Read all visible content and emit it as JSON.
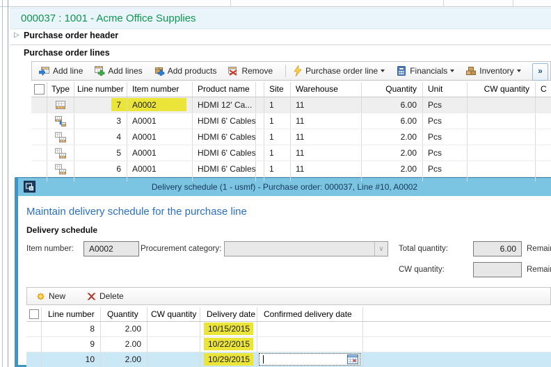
{
  "colors": {
    "accent_green": "#10964f",
    "dialog_border_blue": "#3e95c6",
    "dialog_titlebar_blue": "#7cc5e2",
    "highlight_yellow": "#ebe53a",
    "selected_row_blue": "#cbe8f6",
    "heading_blue": "#2a6fc2"
  },
  "icons": {
    "expander": "▷",
    "overflow": "»",
    "dropdown_caret": "∨"
  },
  "po_form": {
    "title": "000037 : 1001 - Acme Office Supplies",
    "header_section_label": "Purchase order header",
    "lines_section_label": "Purchase order lines",
    "toolbar": {
      "add_line": "Add line",
      "add_lines": "Add lines",
      "add_products": "Add products",
      "remove": "Remove",
      "purchase_order_line": "Purchase order line",
      "financials": "Financials",
      "inventory": "Inventory"
    },
    "grid": {
      "headers": {
        "type": "Type",
        "line": "Line number",
        "item": "Item number",
        "product": "Product name",
        "site": "Site",
        "wh": "Warehouse",
        "qty": "Quantity",
        "unit": "Unit",
        "cw": "CW quantity",
        "last": "C"
      },
      "rows": [
        {
          "line": "7",
          "item": "A0002",
          "product": "HDMI 12' Ca...",
          "site": "1",
          "wh": "11",
          "qty": "6.00",
          "unit": "Pcs"
        },
        {
          "line": "3",
          "item": "A0001",
          "product": "HDMI 6' Cables",
          "site": "1",
          "wh": "11",
          "qty": "6.00",
          "unit": "Pcs"
        },
        {
          "line": "4",
          "item": "A0001",
          "product": "HDMI 6' Cables",
          "site": "1",
          "wh": "11",
          "qty": "2.00",
          "unit": "Pcs"
        },
        {
          "line": "5",
          "item": "A0001",
          "product": "HDMI 6' Cables",
          "site": "1",
          "wh": "11",
          "qty": "2.00",
          "unit": "Pcs"
        },
        {
          "line": "6",
          "item": "A0001",
          "product": "HDMI 6' Cables",
          "site": "1",
          "wh": "11",
          "qty": "2.00",
          "unit": "Pcs"
        }
      ]
    }
  },
  "dialog": {
    "title": "Delivery schedule (1 - usmf) - Purchase order: 000037, Line #10, A0002",
    "heading": "Maintain delivery schedule for the purchase line",
    "group_label": "Delivery schedule",
    "fields": {
      "item_number_label": "Item number:",
      "item_number_value": "A0002",
      "procurement_label": "Procurement category:",
      "procurement_value": "",
      "total_qty_label": "Total quantity:",
      "total_qty_value": "6.00",
      "remaining_label_1": "Remaining",
      "cw_qty_label": "CW quantity:",
      "cw_qty_value": "",
      "remaining_label_2": "Remaining"
    },
    "toolbar": {
      "new": "New",
      "delete": "Delete"
    },
    "grid": {
      "headers": {
        "line": "Line number",
        "qty": "Quantity",
        "cw": "CW quantity",
        "date": "Delivery date",
        "conf": "Confirmed delivery date"
      },
      "rows": [
        {
          "line": "8",
          "qty": "2.00",
          "cw": "",
          "date": "10/15/2015",
          "conf": ""
        },
        {
          "line": "9",
          "qty": "2.00",
          "cw": "",
          "date": "10/22/2015",
          "conf": ""
        },
        {
          "line": "10",
          "qty": "2.00",
          "cw": "",
          "date": "10/29/2015",
          "conf": ""
        }
      ]
    }
  }
}
